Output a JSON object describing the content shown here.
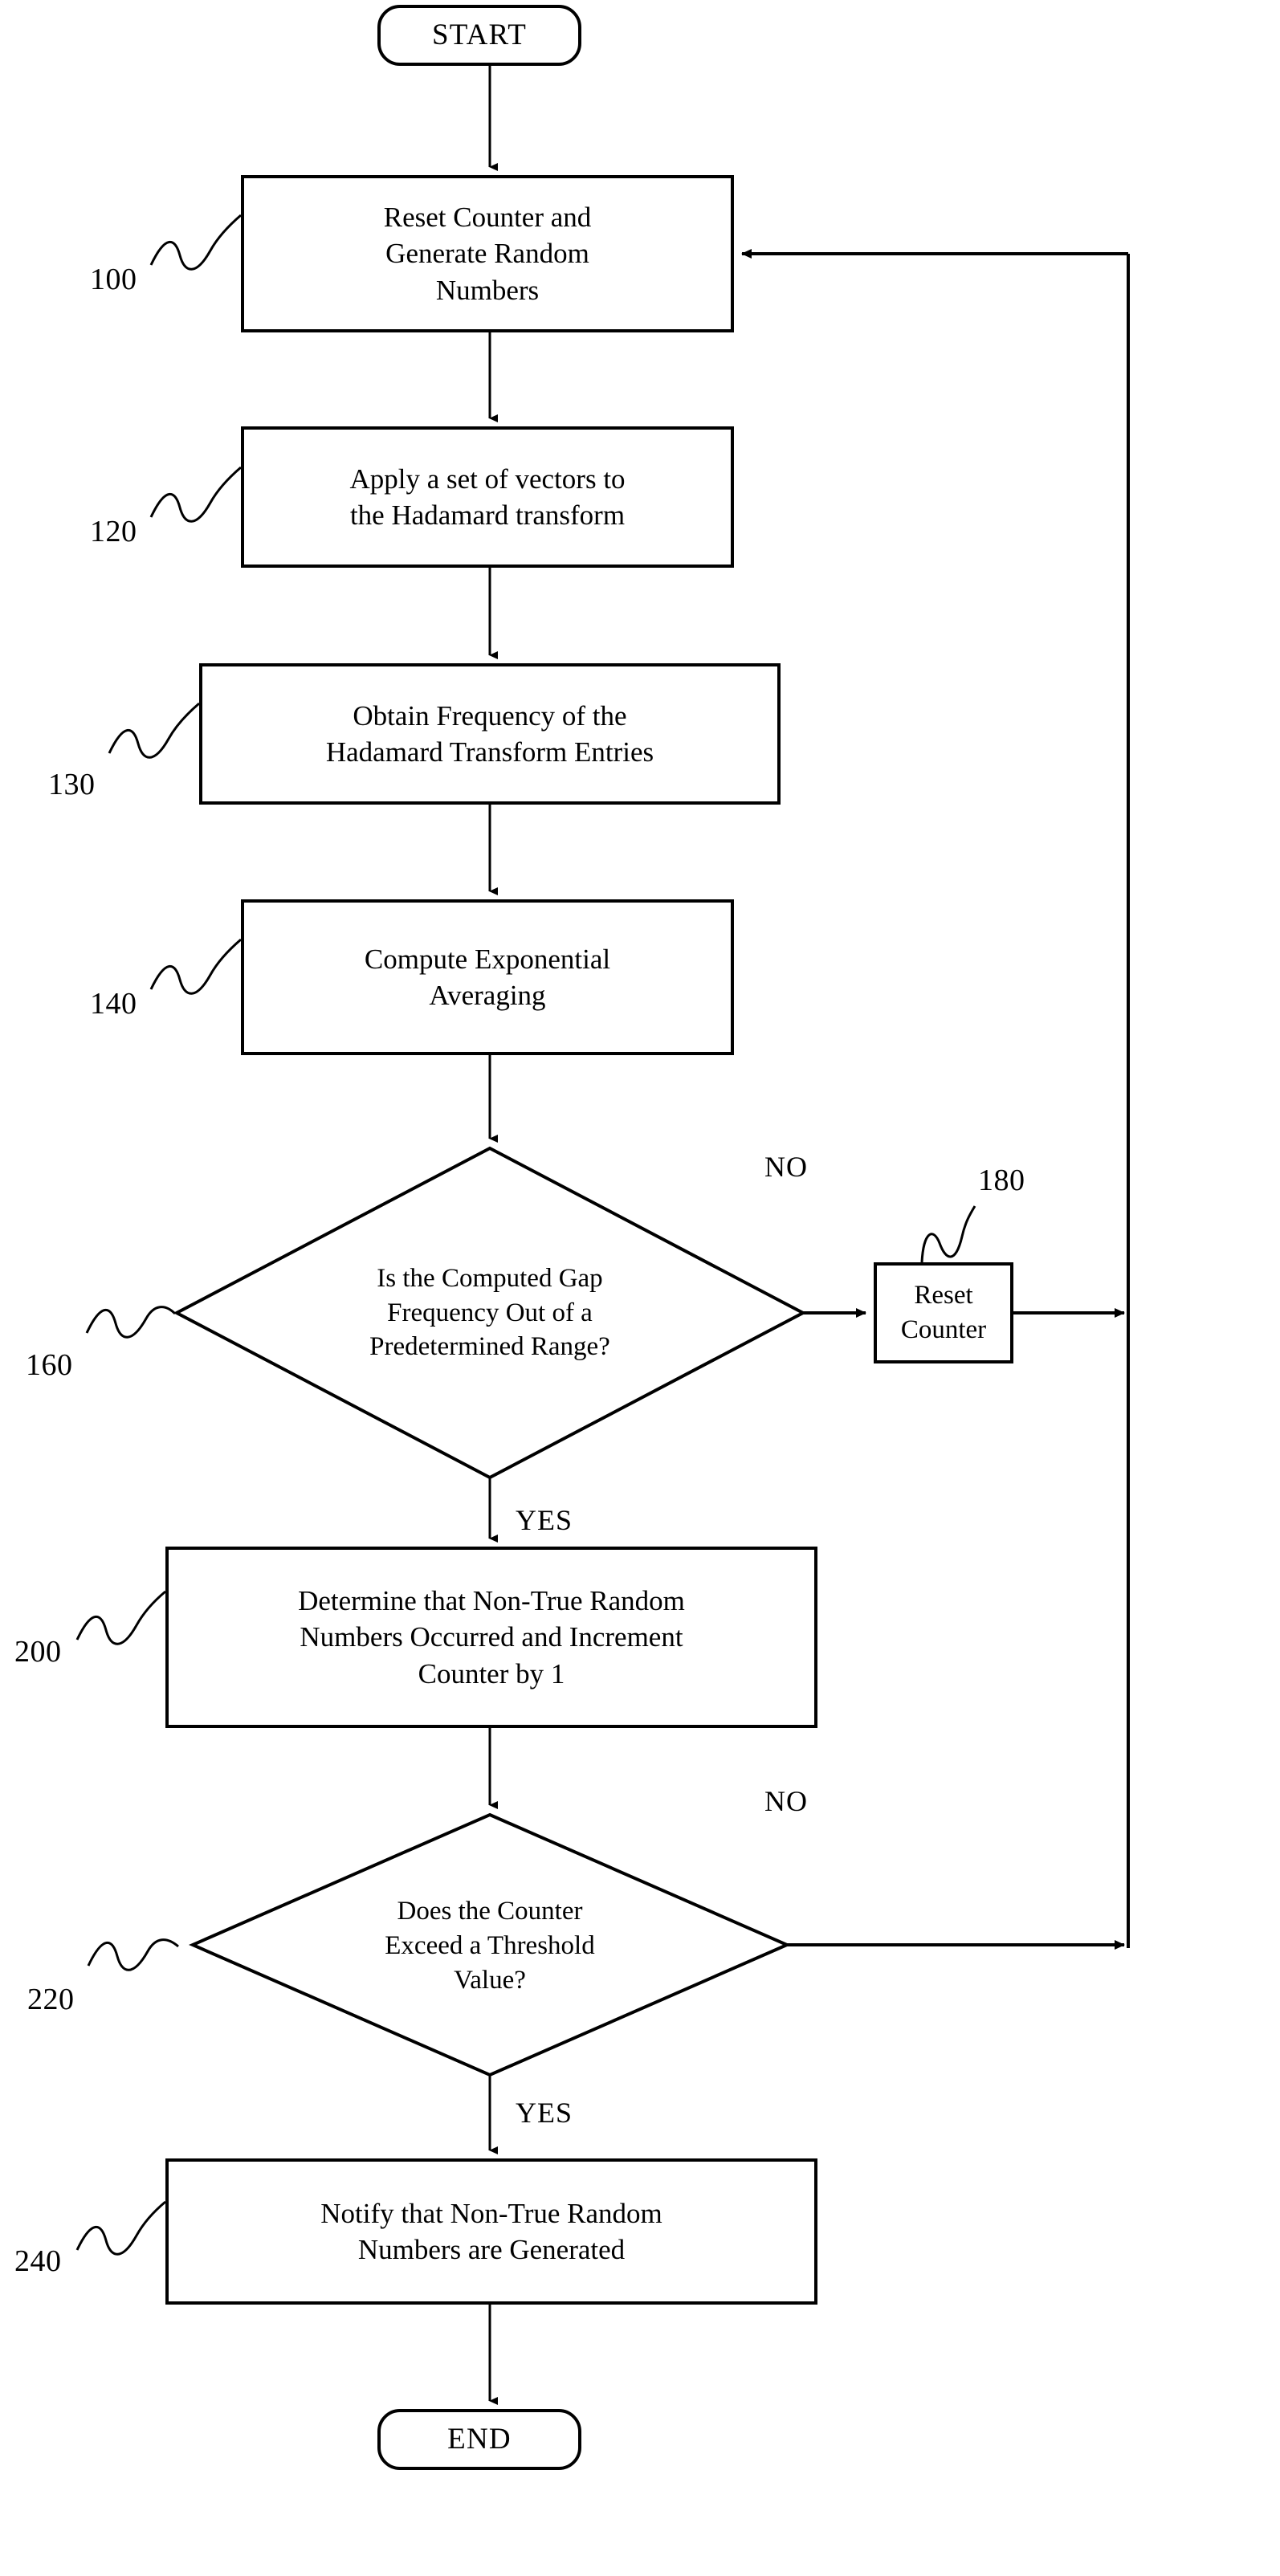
{
  "diagram": {
    "type": "flowchart",
    "title": "",
    "nodes": {
      "start": {
        "label": "START",
        "shape": "terminal"
      },
      "n100": {
        "label": "Reset Counter and\nGenerate Random\nNumbers",
        "shape": "process",
        "ref": "100"
      },
      "n120": {
        "label": "Apply a set of vectors to\nthe Hadamard transform",
        "shape": "process",
        "ref": "120"
      },
      "n130": {
        "label": "Obtain Frequency of the\nHadamard Transform Entries",
        "shape": "process",
        "ref": "130"
      },
      "n140": {
        "label": "Compute Exponential\nAveraging",
        "shape": "process",
        "ref": "140"
      },
      "n160": {
        "label": "Is the Computed Gap\nFrequency Out of a\nPredetermined Range?",
        "shape": "decision",
        "ref": "160"
      },
      "n180": {
        "label": "Reset\nCounter",
        "shape": "process",
        "ref": "180"
      },
      "n200": {
        "label": "Determine that Non-True Random\nNumbers Occurred and Increment\nCounter by 1",
        "shape": "process",
        "ref": "200"
      },
      "n220": {
        "label": "Does the Counter\nExceed a Threshold\nValue?",
        "shape": "decision",
        "ref": "220"
      },
      "n240": {
        "label": "Notify that Non-True Random\nNumbers are Generated",
        "shape": "process",
        "ref": "240"
      },
      "end": {
        "label": "END",
        "shape": "terminal"
      }
    },
    "branch_labels": {
      "no_160": "NO",
      "yes_160": "YES",
      "no_220": "NO",
      "yes_220": "YES"
    },
    "edges": [
      {
        "from": "start",
        "to": "n100",
        "label": ""
      },
      {
        "from": "n100",
        "to": "n120",
        "label": ""
      },
      {
        "from": "n120",
        "to": "n130",
        "label": ""
      },
      {
        "from": "n130",
        "to": "n140",
        "label": ""
      },
      {
        "from": "n140",
        "to": "n160",
        "label": ""
      },
      {
        "from": "n160",
        "to": "n180",
        "label": "NO"
      },
      {
        "from": "n180",
        "to": "n100",
        "label": ""
      },
      {
        "from": "n160",
        "to": "n200",
        "label": "YES"
      },
      {
        "from": "n200",
        "to": "n220",
        "label": ""
      },
      {
        "from": "n220",
        "to": "n100",
        "label": "NO"
      },
      {
        "from": "n220",
        "to": "n240",
        "label": "YES"
      },
      {
        "from": "n240",
        "to": "end",
        "label": ""
      }
    ],
    "colors": {
      "stroke": "#000000",
      "background": "#ffffff",
      "text": "#000000"
    }
  }
}
